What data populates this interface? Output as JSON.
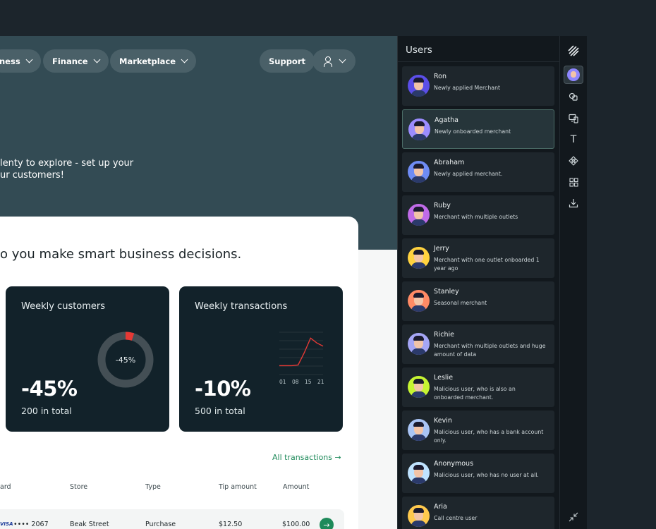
{
  "nav": {
    "items": [
      {
        "label": "ness"
      },
      {
        "label": "Finance"
      },
      {
        "label": "Marketplace"
      }
    ],
    "support_label": "Support"
  },
  "hero": {
    "line1": "lenty to explore - set up your",
    "line2": "ur customers!"
  },
  "card": {
    "heading": "o you make smart business decisions.",
    "weekly_customers": {
      "title": "Weekly customers",
      "value": "-45%",
      "subtitle": "200 in total",
      "donut_label": "-45%"
    },
    "weekly_transactions": {
      "title": "Weekly transactions",
      "value": "-10%",
      "subtitle": "500 in total"
    },
    "all_transactions_link": "All transactions →"
  },
  "chart_data": [
    {
      "type": "pie",
      "title": "",
      "values": [
        0.05,
        0.95
      ],
      "center_label": "-45%",
      "colors": [
        "#e53935",
        "#444f55"
      ]
    },
    {
      "type": "line",
      "title": "",
      "x": [
        "01",
        "08",
        "15",
        "21"
      ],
      "series": [
        {
          "values": [
            0.1,
            0.1,
            0.1,
            0.12,
            0.5,
            0.95,
            0.8,
            0.7
          ]
        }
      ],
      "color": "#e53935"
    }
  ],
  "table": {
    "headers": [
      "ard",
      "Store",
      "Type",
      "Tip amount",
      "Amount"
    ],
    "rows": [
      {
        "card_brand": "VISA",
        "card": "•••• 2067",
        "store": "Beak Street",
        "type": "Purchase",
        "tip": "$12.50",
        "amount": "$100.00"
      }
    ]
  },
  "users_panel": {
    "title": "Users",
    "users": [
      {
        "name": "Ron",
        "desc": "Newly applied Merchant",
        "avatar_bg": "#5b4ee8"
      },
      {
        "name": "Agatha",
        "desc": "Newly onboarded merchant",
        "avatar_bg": "#9b8cff"
      },
      {
        "name": "Abraham",
        "desc": "Newly applied merchant.",
        "avatar_bg": "#6f8cf5"
      },
      {
        "name": "Ruby",
        "desc": "Merchant with multiple outlets",
        "avatar_bg": "#c06be8"
      },
      {
        "name": "Jerry",
        "desc": "Merchant with one outlet onboarded 1 year ago",
        "avatar_bg": "#ffd23f"
      },
      {
        "name": "Stanley",
        "desc": "Seasonal merchant",
        "avatar_bg": "#ff8a65"
      },
      {
        "name": "Richie",
        "desc": "Merchant with multiple outlets and huge amount of data",
        "avatar_bg": "#a5a6f6"
      },
      {
        "name": "Leslie",
        "desc": "Malicious user, who is also an onboarded merchant.",
        "avatar_bg": "#c6f432"
      },
      {
        "name": "Kevin",
        "desc": "Malicious user, who has a bank account only.",
        "avatar_bg": "#a9c4f5"
      },
      {
        "name": "Anonymous",
        "desc": "Malicious user, who has no user at all.",
        "avatar_bg": "#bfe3ff"
      },
      {
        "name": "Aria",
        "desc": "Call centre user",
        "avatar_bg": "#ffc94d"
      }
    ]
  },
  "rail": {
    "icons": [
      "logo-icon",
      "user-avatar-icon",
      "components-icon",
      "devices-icon",
      "text-icon",
      "component-icon",
      "grid-icon",
      "download-icon",
      "collapse-icon"
    ],
    "text_glyph": "T"
  }
}
